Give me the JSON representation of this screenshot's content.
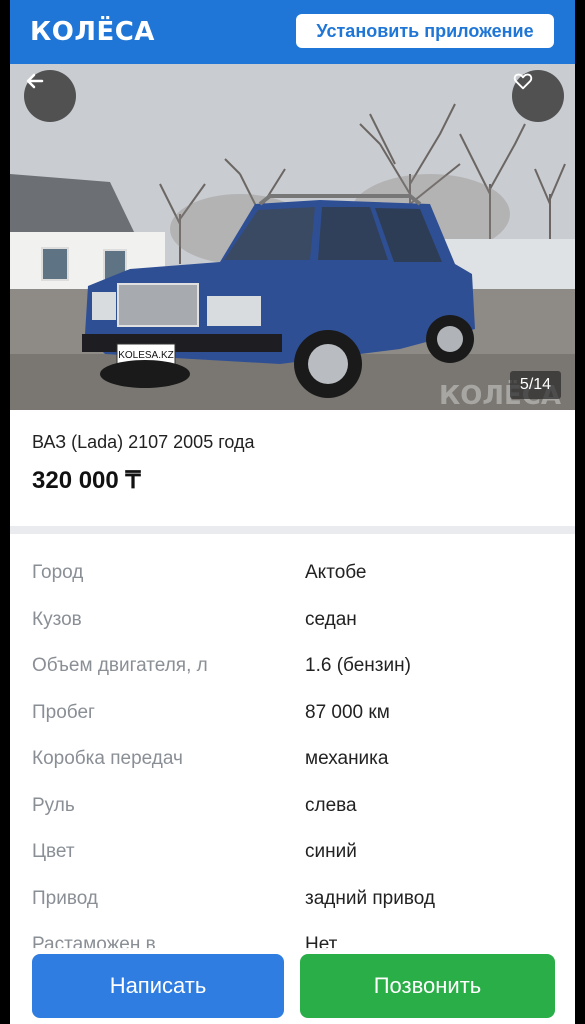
{
  "header": {
    "logo": "КОЛЁСА",
    "install_button": "Установить приложение",
    "brand_color": "#1f76d6"
  },
  "photo": {
    "counter": "5/14",
    "plate_text": "KOLESA.KZ",
    "watermark": "КОЛЁСА",
    "back_icon": "arrow-left-icon",
    "favorite_icon": "heart-icon"
  },
  "listing": {
    "title": "ВАЗ (Lada) 2107 2005 года",
    "price": "320 000 ₸"
  },
  "specs": [
    {
      "label": "Город",
      "value": "Актобе"
    },
    {
      "label": "Кузов",
      "value": "седан"
    },
    {
      "label": "Объем двигателя, л",
      "value": "1.6 (бензин)"
    },
    {
      "label": "Пробег",
      "value": "87 000 км"
    },
    {
      "label": "Коробка передач",
      "value": "механика"
    },
    {
      "label": "Руль",
      "value": "слева"
    },
    {
      "label": "Цвет",
      "value": "синий"
    },
    {
      "label": "Привод",
      "value": "задний привод"
    },
    {
      "label": "Растаможен в",
      "value": "Нет"
    }
  ],
  "actions": {
    "write": "Написать",
    "call": "Позвонить",
    "write_color": "#2f7de1",
    "call_color": "#2aae48"
  }
}
